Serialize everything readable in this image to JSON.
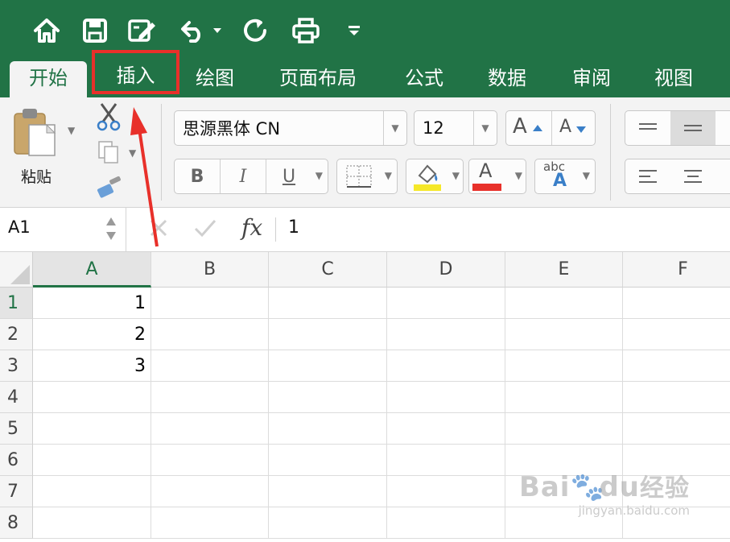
{
  "quick_access": {
    "icons": [
      "home-icon",
      "save-icon",
      "edit-document-icon",
      "undo-icon",
      "redo-icon",
      "print-icon",
      "customize-toolbar-icon"
    ]
  },
  "tabs": [
    {
      "id": "home",
      "label": "开始",
      "active": true
    },
    {
      "id": "insert",
      "label": "插入",
      "highlighted": true
    },
    {
      "id": "draw",
      "label": "绘图"
    },
    {
      "id": "layout",
      "label": "页面布局"
    },
    {
      "id": "formulas",
      "label": "公式"
    },
    {
      "id": "data",
      "label": "数据"
    },
    {
      "id": "review",
      "label": "审阅"
    },
    {
      "id": "view",
      "label": "视图"
    }
  ],
  "ribbon": {
    "paste_label": "粘贴",
    "font_name": "思源黑体 CN",
    "font_size": "12",
    "increase_font_label": "A",
    "decrease_font_label": "A",
    "bold_label": "B",
    "italic_label": "I",
    "underline_label": "U",
    "font_color_label": "A",
    "abc_label": "abc",
    "abc_sub_label": "A",
    "highlight_color": "#f5e829",
    "font_color": "#e8302a"
  },
  "formula_bar": {
    "name_box": "A1",
    "fx_label": "fx",
    "value": "1"
  },
  "grid": {
    "columns": [
      "A",
      "B",
      "C",
      "D",
      "E",
      "F"
    ],
    "rows": [
      "1",
      "2",
      "3",
      "4",
      "5",
      "6",
      "7",
      "8"
    ],
    "cells": [
      {
        "ref": "A1",
        "value": "1"
      },
      {
        "ref": "A2",
        "value": "2"
      },
      {
        "ref": "A3",
        "value": "3"
      }
    ],
    "selected_cell": "A1"
  },
  "watermark": {
    "brand_text": "Bai",
    "brand_suffix": "du",
    "cn_text": "经验",
    "url": "jingyan.baidu.com"
  },
  "colors": {
    "excel_green": "#217346",
    "annotation_red": "#e8302a"
  }
}
